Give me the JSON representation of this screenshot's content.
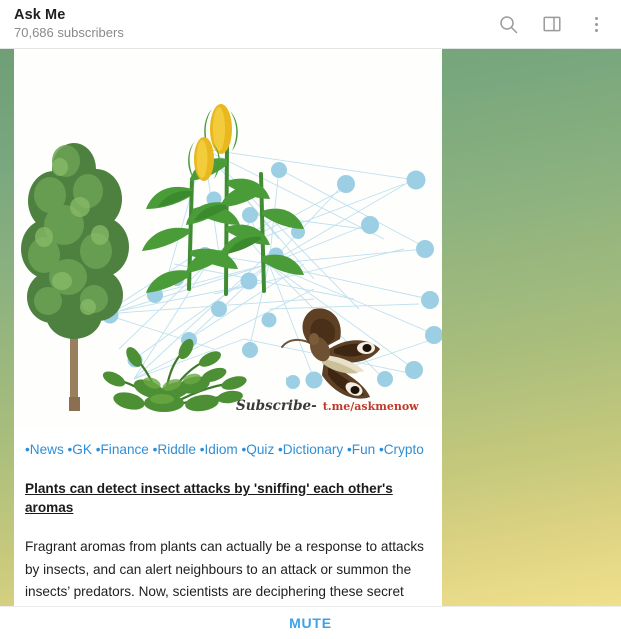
{
  "header": {
    "title": "Ask Me",
    "subtitle": "70,686 subscribers",
    "icons": {
      "search": "search-icon",
      "split_view": "split-view-icon",
      "more": "more-vertical-icon"
    }
  },
  "message": {
    "photo": {
      "alt": "Network diagram of plants communicating",
      "elements": [
        "tree",
        "corn-plant",
        "fern-bush",
        "moth",
        "network-nodes"
      ],
      "node_color": "#9ccfe4",
      "link_color": "#bcdfee",
      "watermark": {
        "label": "Subscribe-",
        "url": "t.me/askmenow",
        "url_color": "#c0392b"
      }
    },
    "tags": [
      "•News",
      "•GK",
      "•Finance",
      "•Riddle",
      "•Idiom",
      "•Quiz",
      "•Dictionary",
      "•Fun",
      "•Crypto"
    ],
    "tag_color": "#2f8fd6",
    "headline": "Plants can detect insect attacks by 'sniffing' each other's aromas",
    "paragraph": "Fragrant aromas from plants can actually be a response to attacks by insects, and can alert neighbours to an attack or summon the insects’ predators. Now, scientists are deciphering these secret codes to develop better, greener chemicals to defend crops against"
  },
  "footer": {
    "mute_label": "MUTE",
    "mute_color": "#3aa3e8"
  },
  "theme": {
    "wallpaper_top": "#6f9f76",
    "wallpaper_bottom": "#efe08c",
    "bubble_bg": "#ffffff"
  }
}
